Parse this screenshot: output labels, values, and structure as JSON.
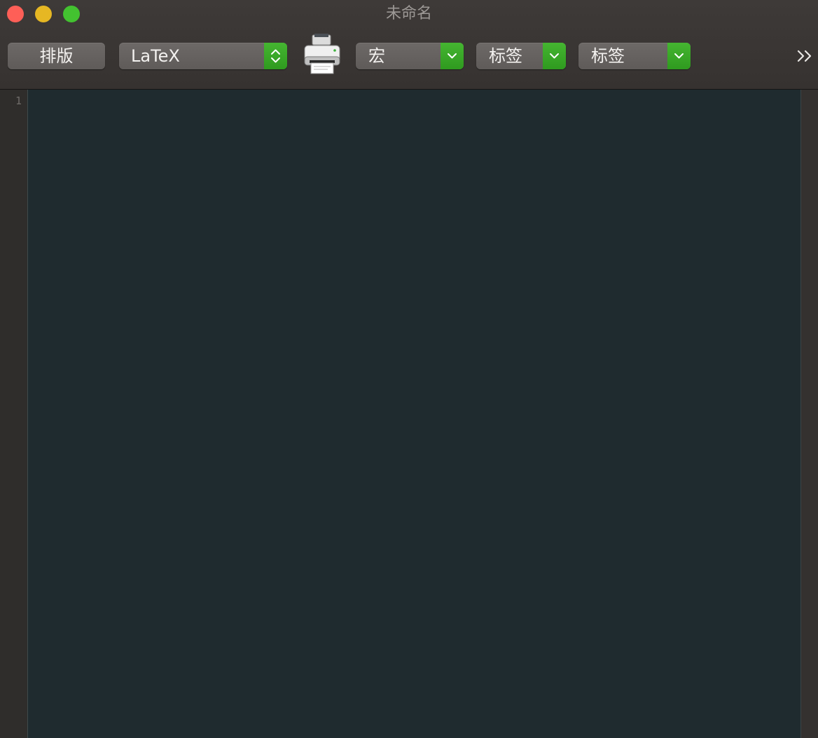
{
  "window": {
    "title": "未命名"
  },
  "toolbar": {
    "typeset_label": "排版",
    "engine_popup": {
      "selected": "LaTeX"
    },
    "macros_popup": {
      "selected": "宏"
    },
    "tags_popup_1": {
      "selected": "标签"
    },
    "tags_popup_2": {
      "selected": "标签"
    },
    "print_icon": "printer-icon",
    "overflow_icon": "chevron-double-right-icon"
  },
  "editor": {
    "line_numbers": [
      "1"
    ],
    "content": ""
  },
  "colors": {
    "accent_green": "#3aa827",
    "editor_background": "#1f2b2f",
    "toolbar_background": "#3a3634"
  }
}
